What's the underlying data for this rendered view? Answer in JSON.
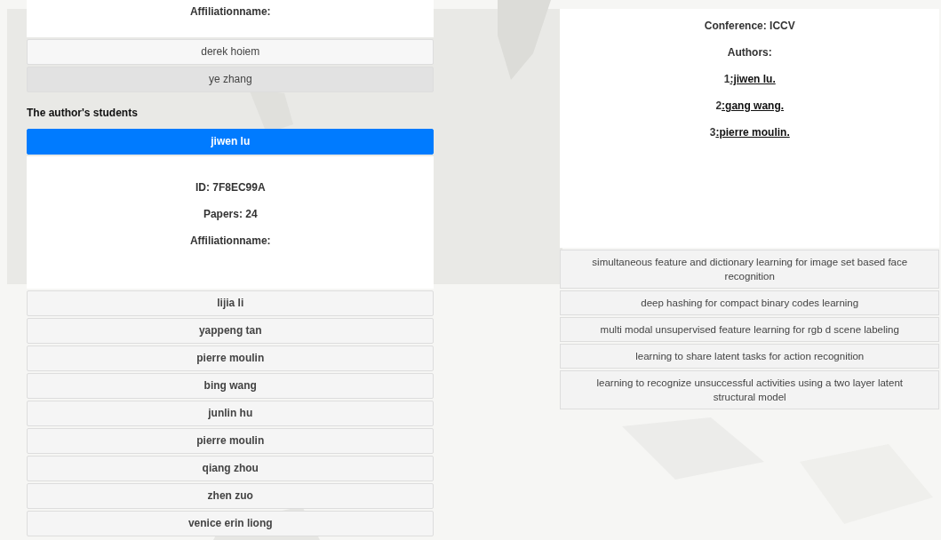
{
  "author_card": {
    "fields": [
      "Affiliationname:"
    ]
  },
  "coauthors": [
    {
      "name": "derek hoiem",
      "selected": false
    },
    {
      "name": "ye zhang",
      "selected": true
    }
  ],
  "students_heading": "The author's students",
  "students": [
    {
      "name": "jiwen lu",
      "expanded": true,
      "fields": [
        "ID: 7F8EC99A",
        "Papers: 24",
        "Affiliationname:"
      ]
    },
    {
      "name": "lijia li",
      "expanded": false
    },
    {
      "name": "yappeng tan",
      "expanded": false
    },
    {
      "name": "pierre moulin",
      "expanded": false
    },
    {
      "name": "bing wang",
      "expanded": false
    },
    {
      "name": "junlin hu",
      "expanded": false
    },
    {
      "name": "pierre moulin",
      "expanded": false
    },
    {
      "name": "qiang zhou",
      "expanded": false
    },
    {
      "name": "zhen zuo",
      "expanded": false
    },
    {
      "name": "venice erin liong",
      "expanded": false
    }
  ],
  "paper_card": {
    "conference": "Conference: ICCV",
    "authors_label": "Authors:",
    "authors": [
      {
        "number": "1",
        "name": ":jiwen lu."
      },
      {
        "number": "2",
        "name": ":gang wang."
      },
      {
        "number": "3",
        "name": ":pierre moulin."
      }
    ]
  },
  "papers": [
    "simultaneous feature and dictionary learning for image set based face recognition",
    "deep hashing for compact binary codes learning",
    "multi modal unsupervised feature learning for rgb d scene labeling",
    "learning to share latent tasks for action recognition",
    "learning to recognize unsuccessful activities using a two layer latent structural model"
  ]
}
